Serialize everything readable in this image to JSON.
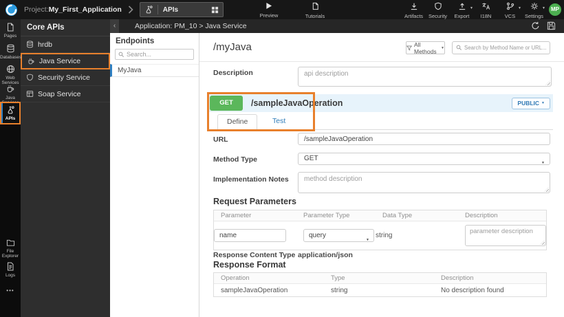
{
  "colors": {
    "accent_orange": "#e8802c",
    "get_green": "#5bb75b",
    "link_blue": "#2e7cb8",
    "selected_blue": "#2f80c3",
    "avatar_green": "#4caf50",
    "operation_row_bg": "#e7f3fb"
  },
  "topbar": {
    "project_label": "Project:",
    "project_name": "My_First_Application",
    "tab_label": "APIs",
    "preview_label": "Preview",
    "tutorials_label": "Tutorials",
    "menu": [
      {
        "label": "Artifacts"
      },
      {
        "label": "Security"
      },
      {
        "label": "Export"
      },
      {
        "label": "I18N"
      },
      {
        "label": "VCS"
      },
      {
        "label": "Settings"
      }
    ],
    "avatar_initials": "MP"
  },
  "sidebar": {
    "items": [
      {
        "label": "Pages"
      },
      {
        "label": "Databases"
      },
      {
        "label": "Web Services"
      },
      {
        "label": "Java Services"
      },
      {
        "label": "APIs"
      }
    ],
    "selected": "APIs",
    "bottom_items": [
      {
        "label": "File Explorer"
      },
      {
        "label": "Logs"
      }
    ],
    "more_label": "•••"
  },
  "core_apis": {
    "title": "Core APIs",
    "items": [
      {
        "label": "hrdb"
      },
      {
        "label": "Java Service"
      },
      {
        "label": "Security Service"
      },
      {
        "label": "Soap Service"
      }
    ],
    "selected": "Java Service"
  },
  "breadcrumb": {
    "text": "Application: PM_10 > Java Service"
  },
  "endpoints": {
    "title": "Endpoints",
    "search_placeholder": "Search...",
    "items": [
      {
        "label": "MyJava"
      }
    ],
    "selected": "MyJava"
  },
  "main": {
    "title": "/myJava",
    "methods_filter_label": "All Methods",
    "search_placeholder": "Search by Method Name or URL...",
    "description_label": "Description",
    "description_placeholder": "api description",
    "operation": {
      "method": "GET",
      "path": "/sampleJavaOperation",
      "visibility_label": "PUBLIC"
    },
    "tabs": [
      {
        "label": "Define",
        "active": true
      },
      {
        "label": "Test",
        "active": false
      }
    ],
    "form": {
      "url_label": "URL",
      "url_value": "/sampleJavaOperation",
      "method_type_label": "Method Type",
      "method_type_value": "GET",
      "implementation_notes_label": "Implementation Notes",
      "implementation_notes_placeholder": "method description"
    },
    "request_parameters": {
      "title": "Request Parameters",
      "headers": [
        "Parameter",
        "Parameter Type",
        "Data Type",
        "Description"
      ],
      "row": {
        "parameter_value": "name",
        "parameter_type_value": "query",
        "data_type": "string",
        "description_placeholder": "parameter description"
      }
    },
    "response": {
      "content_type_label": "Response Content Type",
      "content_type_value": "application/json",
      "format_title": "Response Format",
      "headers": [
        "Operation",
        "Type",
        "Description"
      ],
      "rows": [
        {
          "operation": "sampleJavaOperation",
          "type": "string",
          "description": "No description found"
        }
      ]
    }
  }
}
